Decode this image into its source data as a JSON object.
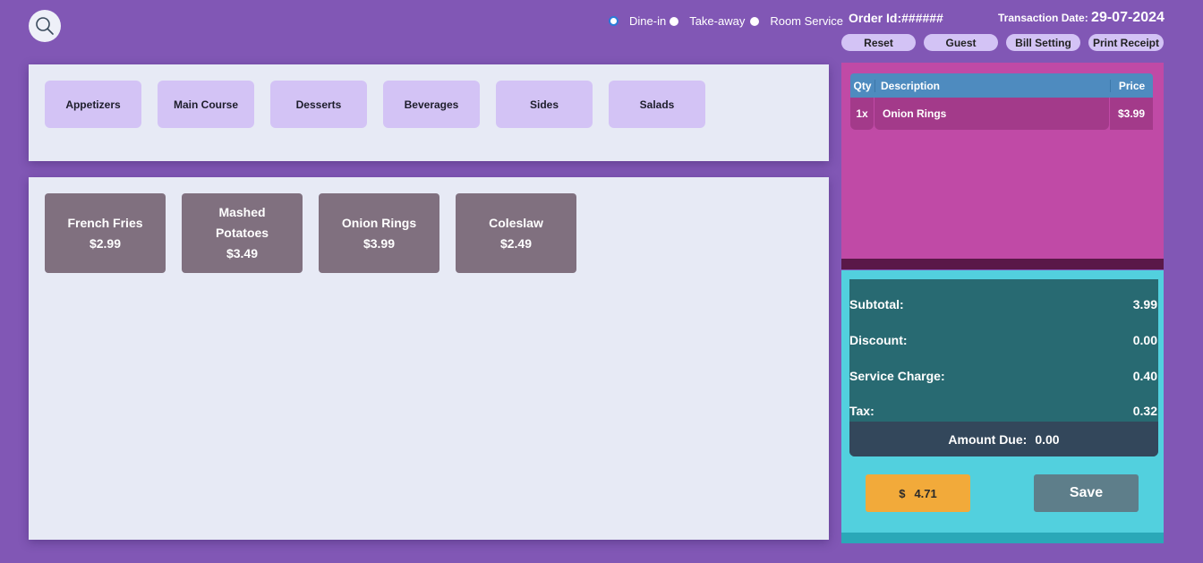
{
  "header": {
    "search_icon": "search-icon",
    "order_types": [
      {
        "label": "Dine-in",
        "checked": true
      },
      {
        "label": "Take-away",
        "checked": false
      },
      {
        "label": "Room Service",
        "checked": false
      }
    ],
    "order_id": "Order Id:######",
    "transaction_date_label": "Transaction Date:",
    "transaction_date_value": "29-07-2024",
    "buttons": {
      "reset": "Reset",
      "guest": "Guest",
      "bill_setting": "Bill Setting",
      "print_receipt": "Print Receipt"
    }
  },
  "categories": [
    "Appetizers",
    "Main Course",
    "Desserts",
    "Beverages",
    "Sides",
    "Salads"
  ],
  "items": [
    {
      "name": "French Fries",
      "price": "$2.99"
    },
    {
      "name": "Mashed Potatoes",
      "price": "$3.49"
    },
    {
      "name": "Onion Rings",
      "price": "$3.99"
    },
    {
      "name": "Coleslaw",
      "price": "$2.49"
    }
  ],
  "order": {
    "headers": {
      "qty": "Qty",
      "description": "Description",
      "price": "Price"
    },
    "rows": [
      {
        "qty": "1x",
        "description": "Onion Rings",
        "price": "$3.99"
      }
    ]
  },
  "totals": {
    "subtotal_label": "Subtotal:",
    "subtotal": "3.99",
    "discount_label": "Discount:",
    "discount": "0.00",
    "service_label": "Service Charge:",
    "service": "0.40",
    "tax_label": "Tax:",
    "tax": "0.32",
    "amount_due_label": "Amount Due:",
    "amount_due": "0.00"
  },
  "actions": {
    "currency": "$",
    "pay_amount": "4.71",
    "save": "Save"
  }
}
